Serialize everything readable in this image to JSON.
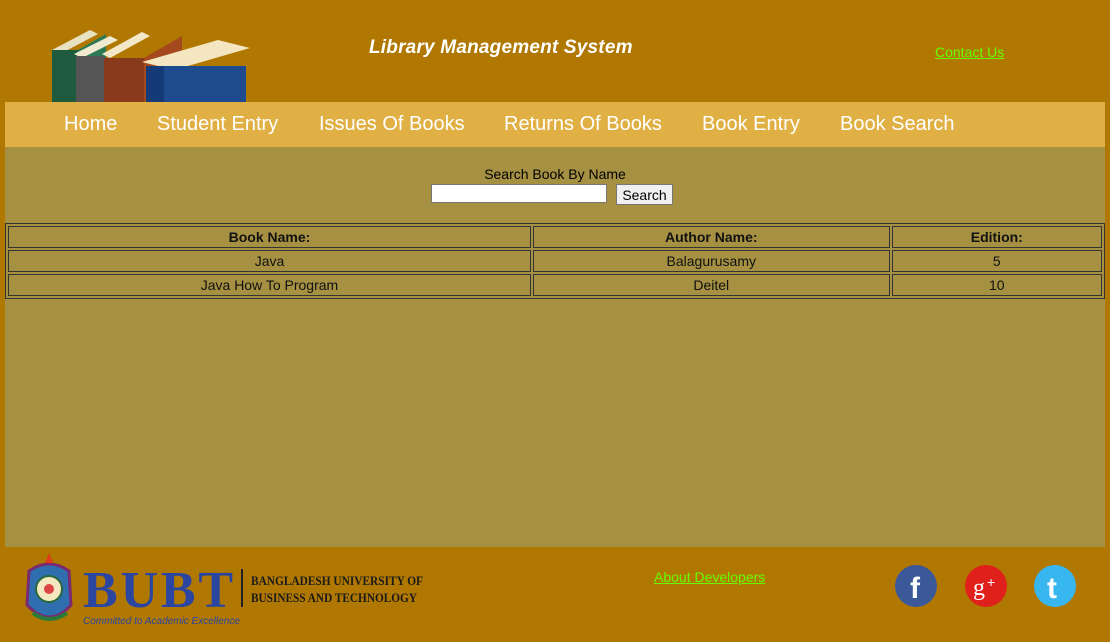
{
  "header": {
    "title": "Library Management System",
    "contact_label": "Contact Us"
  },
  "nav": {
    "items": [
      "Home",
      "Student Entry",
      "Issues Of Books",
      "Returns Of Books",
      "Book Entry",
      "Book Search"
    ]
  },
  "search": {
    "label": "Search Book By Name",
    "input_value": "",
    "button_label": "Search"
  },
  "results": {
    "columns": [
      "Book Name:",
      "Author Name:",
      "Edition:"
    ],
    "rows": [
      [
        "Java",
        "Balagurusamy",
        "5"
      ],
      [
        "Java How To Program",
        "Deitel",
        "10"
      ]
    ]
  },
  "footer": {
    "about_label": "About Developers",
    "logo": {
      "abbr": "BUBT",
      "university_line1": "Bangladesh University of",
      "university_line2": "Business and Technology",
      "tagline": "Committed to Academic Excellence"
    },
    "social": [
      "facebook-icon",
      "google-plus-icon",
      "twitter-icon"
    ]
  },
  "colors": {
    "header_bg": "#b07800",
    "nav_bg": "#e0b044",
    "content_bg": "#a69042",
    "link_green": "#66ff00",
    "facebook": "#3b5998",
    "google": "#e0201a",
    "twitter": "#38b6f0"
  }
}
